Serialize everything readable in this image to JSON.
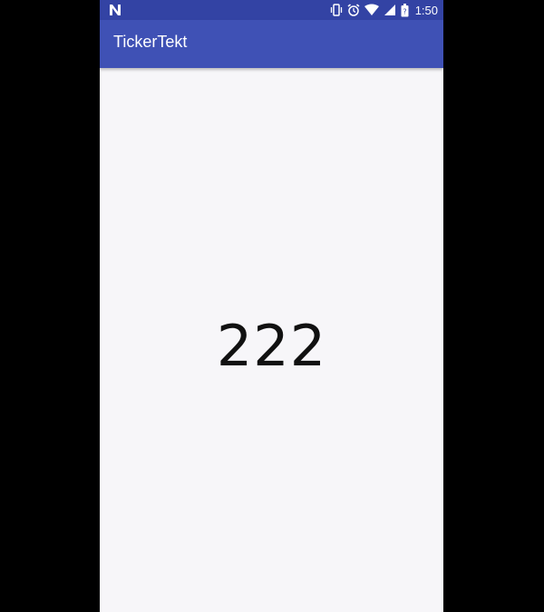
{
  "status_bar": {
    "left_icon": "n-notification-icon",
    "icons": [
      "vibrate-icon",
      "alarm-icon",
      "wifi-icon",
      "signal-icon",
      "battery-icon"
    ],
    "battery_level": "?",
    "time": "1:50"
  },
  "app_bar": {
    "title": "TickerTekt",
    "color": "#3f51b5",
    "status_color": "#3343a4"
  },
  "main": {
    "ticker_value": "222",
    "background": "#f7f6f9"
  }
}
